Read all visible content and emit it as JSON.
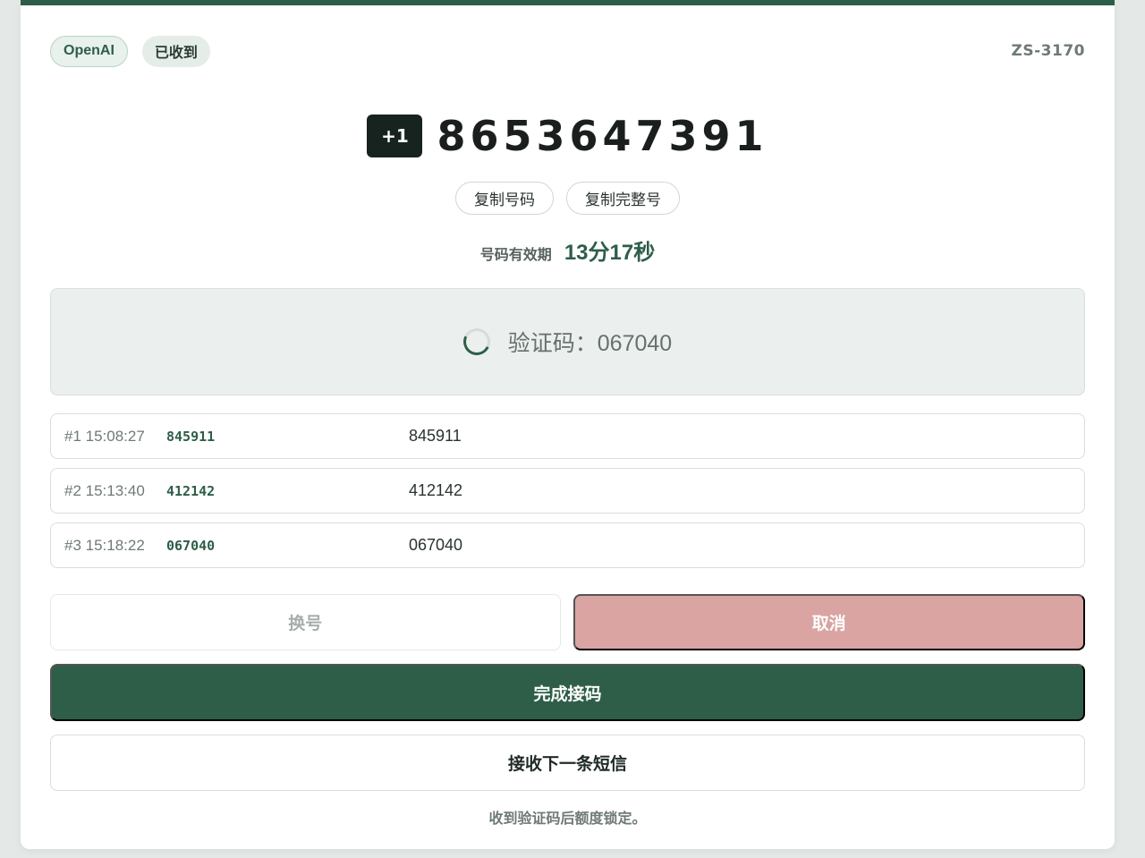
{
  "header": {
    "platform_tag": "OpenAI",
    "status_tag": "已收到",
    "order_id": "ZS-3170"
  },
  "phone": {
    "country_code": "+1",
    "number": "8653647391"
  },
  "copy_buttons": {
    "copy_number": "复制号码",
    "copy_full": "复制完整号"
  },
  "validity": {
    "label": "号码有效期",
    "value": "13分17秒"
  },
  "status": {
    "text": "验证码：067040"
  },
  "sms": [
    {
      "meta": "#1 15:08:27",
      "code": "845911",
      "body": "845911"
    },
    {
      "meta": "#2 15:13:40",
      "code": "412142",
      "body": "412142"
    },
    {
      "meta": "#3 15:18:22",
      "code": "067040",
      "body": "067040"
    }
  ],
  "actions": {
    "swap": "换号",
    "cancel": "取消",
    "complete": "完成接码",
    "next": "接收下一条短信"
  },
  "note": "收到验证码后额度锁定。",
  "colors": {
    "accent": "#2e5e48",
    "cancel": "#d9a4a2",
    "background": "#e4e9e7"
  },
  "icons": {
    "status": "loading-spinner-icon"
  }
}
